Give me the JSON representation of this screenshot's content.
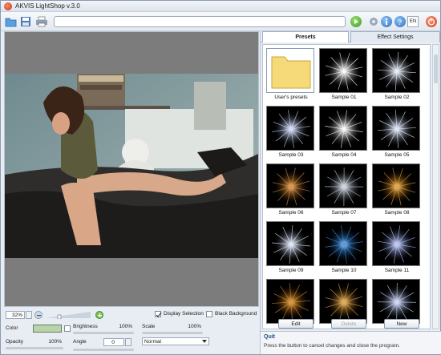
{
  "window": {
    "title": "AKVIS LightShop v.3.0"
  },
  "toolbar": {
    "language": "EN"
  },
  "tabs": [
    {
      "label": "Presets"
    },
    {
      "label": "Effect Settings"
    }
  ],
  "presets": [
    {
      "label": "User's presets",
      "type": "folder"
    },
    {
      "label": "Sample 01",
      "glow": "#ffffff",
      "core": "#ffffff"
    },
    {
      "label": "Sample 02",
      "glow": "#e8f0ff",
      "core": "#ffffff"
    },
    {
      "label": "Sample 03",
      "glow": "#d0dcff",
      "core": "#ffffff"
    },
    {
      "label": "Sample 04",
      "glow": "#ffffff",
      "core": "#ffffff"
    },
    {
      "label": "Sample 05",
      "glow": "#dfe8ff",
      "core": "#ffffff"
    },
    {
      "label": "Sample 06",
      "glow": "#d98a3a",
      "core": "#ffe0a0"
    },
    {
      "label": "Sample 07",
      "glow": "#c9d2e0",
      "core": "#ffffff"
    },
    {
      "label": "Sample 08",
      "glow": "#e89a30",
      "core": "#fff0c0"
    },
    {
      "label": "Sample 09",
      "glow": "#e0e8ff",
      "core": "#ffffff"
    },
    {
      "label": "Sample 10",
      "glow": "#3a8ae0",
      "core": "#dff0ff"
    },
    {
      "label": "Sample 11",
      "glow": "#b0c0ff",
      "core": "#ffffff"
    },
    {
      "label": "",
      "glow": "#d88a2a",
      "core": "#ffd080"
    },
    {
      "label": "",
      "glow": "#e0a040",
      "core": "#fff0c0"
    },
    {
      "label": "",
      "glow": "#c8d4ff",
      "core": "#ffffff"
    }
  ],
  "preset_buttons": {
    "edit": "Edit",
    "delete": "Delete",
    "new": "New"
  },
  "help": {
    "title": "Quit",
    "text": "Press the button to cancel changes and close the program."
  },
  "zoom": {
    "value": "32%"
  },
  "options": {
    "display_selection": "Display Selection",
    "black_background": "Black Background"
  },
  "settings": {
    "color_label": "Color",
    "color_value": "#b8d4a8",
    "brightness_label": "Brightness",
    "brightness_value": "100%",
    "scale_label": "Scale",
    "scale_value": "100%",
    "opacity_label": "Opacity",
    "opacity_value": "100%",
    "angle_label": "Angle",
    "angle_value": "0",
    "blend_mode": "Normal"
  }
}
